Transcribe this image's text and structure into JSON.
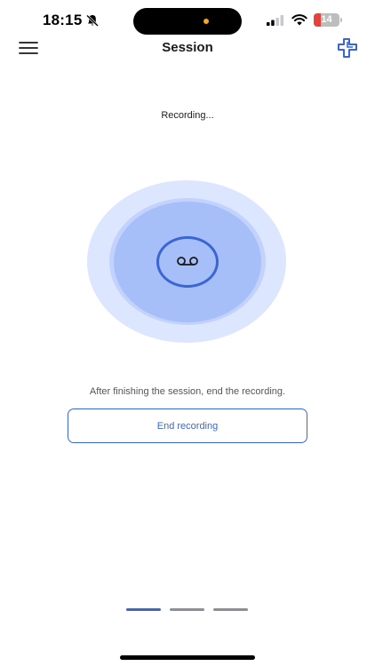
{
  "status_bar": {
    "time": "18:15",
    "battery_level": "14",
    "battery_fraction": 0.14,
    "icons": [
      "bell-slash-icon",
      "cellular-signal-icon",
      "wifi-icon",
      "battery-icon"
    ]
  },
  "nav": {
    "title": "Session",
    "menu_icon": "hamburger-menu-icon",
    "logo_icon": "medical-cross-logo-icon"
  },
  "recording": {
    "status": "Recording...",
    "icon": "voicemail-icon"
  },
  "hint": "After finishing the session, end the recording.",
  "end_button": {
    "label": "End recording"
  },
  "pager": {
    "pages": 3,
    "active": 0
  },
  "colors": {
    "accent": "#3a66d4",
    "halo_outer": "#dce6fe",
    "halo_inner": "#a7bff9",
    "pager_inactive": "#8a8f96",
    "battery_low": "#e4433b"
  }
}
